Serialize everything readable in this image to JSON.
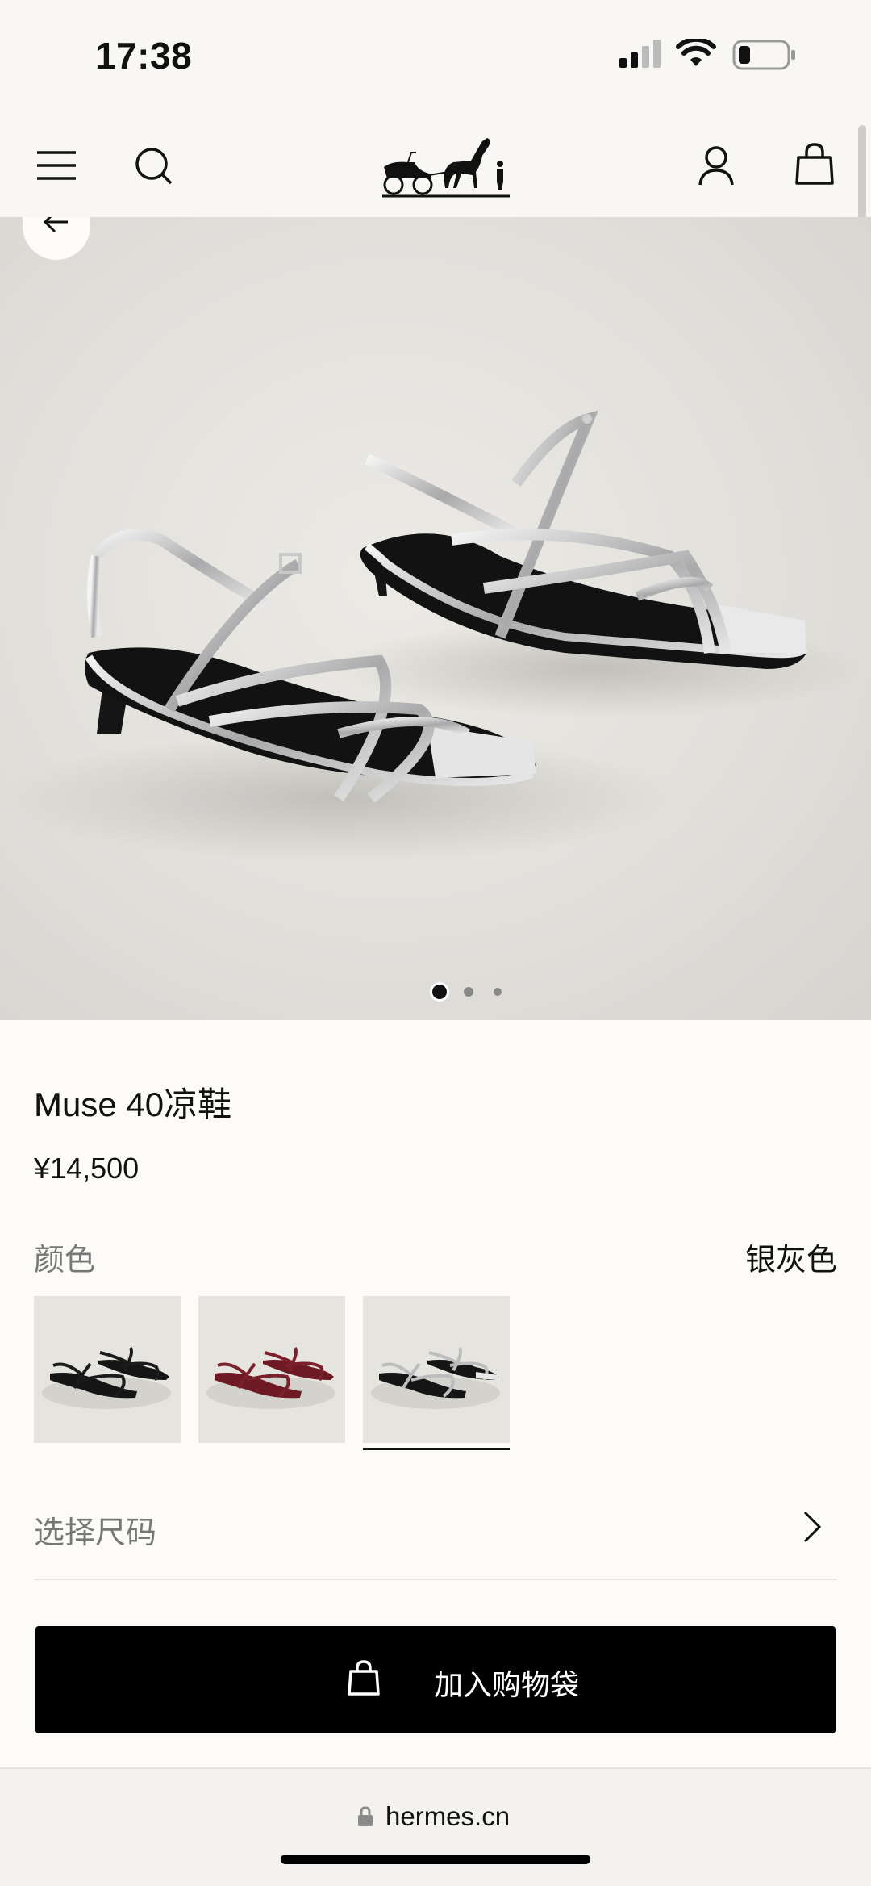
{
  "status_bar": {
    "time": "17:38"
  },
  "header": {
    "icons": [
      "menu-icon",
      "search-icon",
      "hermes-carriage-logo",
      "account-icon",
      "shopping-bag-icon"
    ]
  },
  "gallery": {
    "image_count": 3,
    "active_index": 0
  },
  "product": {
    "title": "Muse 40凉鞋",
    "price": "¥14,500"
  },
  "color": {
    "label": "颜色",
    "selected": "银灰色",
    "swatches": [
      {
        "name": "black",
        "hex": "#151515"
      },
      {
        "name": "burgundy",
        "hex": "#6e1a24"
      },
      {
        "name": "silver",
        "hex": "#b9b9bb"
      }
    ],
    "selected_index": 2
  },
  "size": {
    "label": "选择尺码"
  },
  "cart": {
    "button_label": "加入购物袋"
  },
  "browser": {
    "url": "hermes.cn"
  },
  "colors": {
    "accent": "#000000",
    "background": "#fcfbf7",
    "muted_text": "#777777"
  }
}
